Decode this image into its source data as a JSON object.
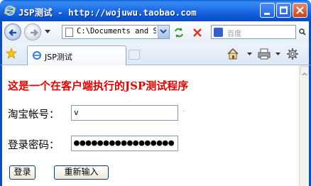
{
  "window": {
    "title": "JSP测试 - http://wojuwu.taobao.com"
  },
  "navbar": {
    "address": "C:\\Documents and S",
    "search_placeholder": "百度"
  },
  "tabs": [
    {
      "label": "JSP测试"
    }
  ],
  "page": {
    "heading": "这是一个在客户端执行的JSP测试程序",
    "username_label": "淘宝帐号：",
    "username_value": "v",
    "password_label": "登录密码：",
    "password_value": "●●●●●●●●●●●●●●●●●",
    "login_button": "登录",
    "reset_button": "重新输入"
  },
  "colors": {
    "titlebar": "#0b57d0",
    "heading": "#e00000",
    "window_border": "#0a4cc4"
  }
}
